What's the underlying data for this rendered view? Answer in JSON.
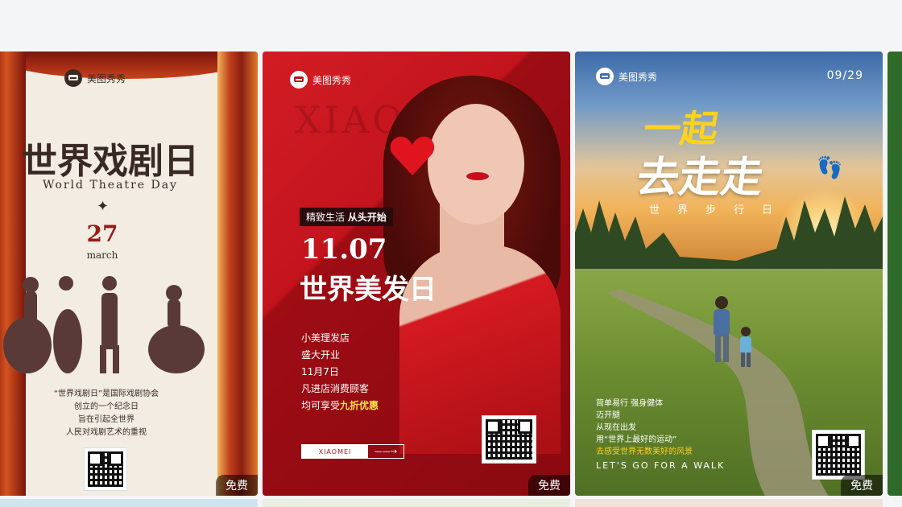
{
  "cards": [
    {
      "brand": "美图秀秀",
      "title": "世界戏剧日",
      "subtitle": "World Theatre Day",
      "day": "27",
      "month": "march",
      "description": [
        "“世界戏剧日”是国际戏剧协会",
        "创立的一个纪念日",
        "旨在引起全世界",
        "人民对戏剧艺术的重视"
      ],
      "badge": "免费"
    },
    {
      "brand": "美图秀秀",
      "bg_text": "XIAO",
      "tag_prefix": "精致生活",
      "tag_bold": "从头开始",
      "date": "11.07",
      "title": "世界美发日",
      "list": [
        "小美理发店",
        "盛大开业",
        "11月7日",
        "凡进店消费顾客"
      ],
      "offer_prefix": "均可享受",
      "offer_highlight": "九折优惠",
      "button_left": "XIAOMEI",
      "button_right": "——→",
      "badge": "免费"
    },
    {
      "brand": "美图秀秀",
      "date": "09/29",
      "title_line1": "一起",
      "title_line2": "去走走",
      "feet_icon": "footprints-icon",
      "subtitle": "世界步行日",
      "list": [
        "简单易行 强身健体",
        "迈开腿",
        "从现在出发",
        "用“世界上最好的运动”"
      ],
      "list_highlight": "去感受世界无数美好的风景",
      "walk": "LET'S GO FOR  A WALK",
      "badge": "免费"
    }
  ],
  "colors": {
    "page_bg": "#f4f5f7",
    "theatre_red": "#9a1a14",
    "hair_red": "#b5121b",
    "walk_yellow": "#ffd21e"
  }
}
